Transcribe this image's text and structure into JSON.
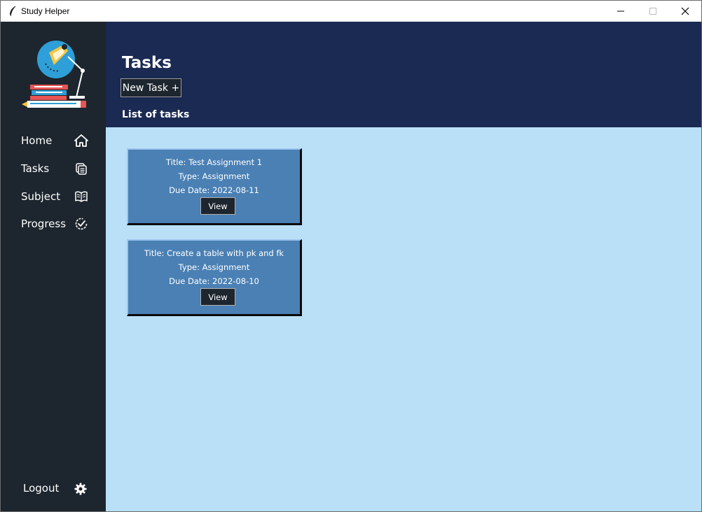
{
  "window": {
    "title": "Study Helper",
    "controls": [
      "minimize",
      "maximize",
      "close"
    ]
  },
  "sidebar": {
    "logo_icon": "study-logo-icon",
    "items": [
      {
        "label": "Home",
        "icon": "home-icon"
      },
      {
        "label": "Tasks",
        "icon": "tasks-icon"
      },
      {
        "label": "Subject",
        "icon": "book-icon"
      },
      {
        "label": "Progress",
        "icon": "progress-check-icon"
      }
    ],
    "logout": {
      "label": "Logout",
      "icon": "gear-icon"
    }
  },
  "header": {
    "title": "Tasks",
    "new_task_label": "New Task +",
    "list_heading": "List of tasks"
  },
  "tasks": [
    {
      "title": "Title: Test Assignment 1",
      "type": "Type: Assignment",
      "due": "Due Date: 2022-08-11",
      "view_label": "View"
    },
    {
      "title": "Title: Create a table with pk and fk",
      "type": "Type: Assignment",
      "due": "Due Date: 2022-08-10",
      "view_label": "View"
    }
  ],
  "colors": {
    "sidebar": "#1d262e",
    "header": "#1a2a53",
    "content": "#bae0f8",
    "card": "#4a80b4"
  }
}
